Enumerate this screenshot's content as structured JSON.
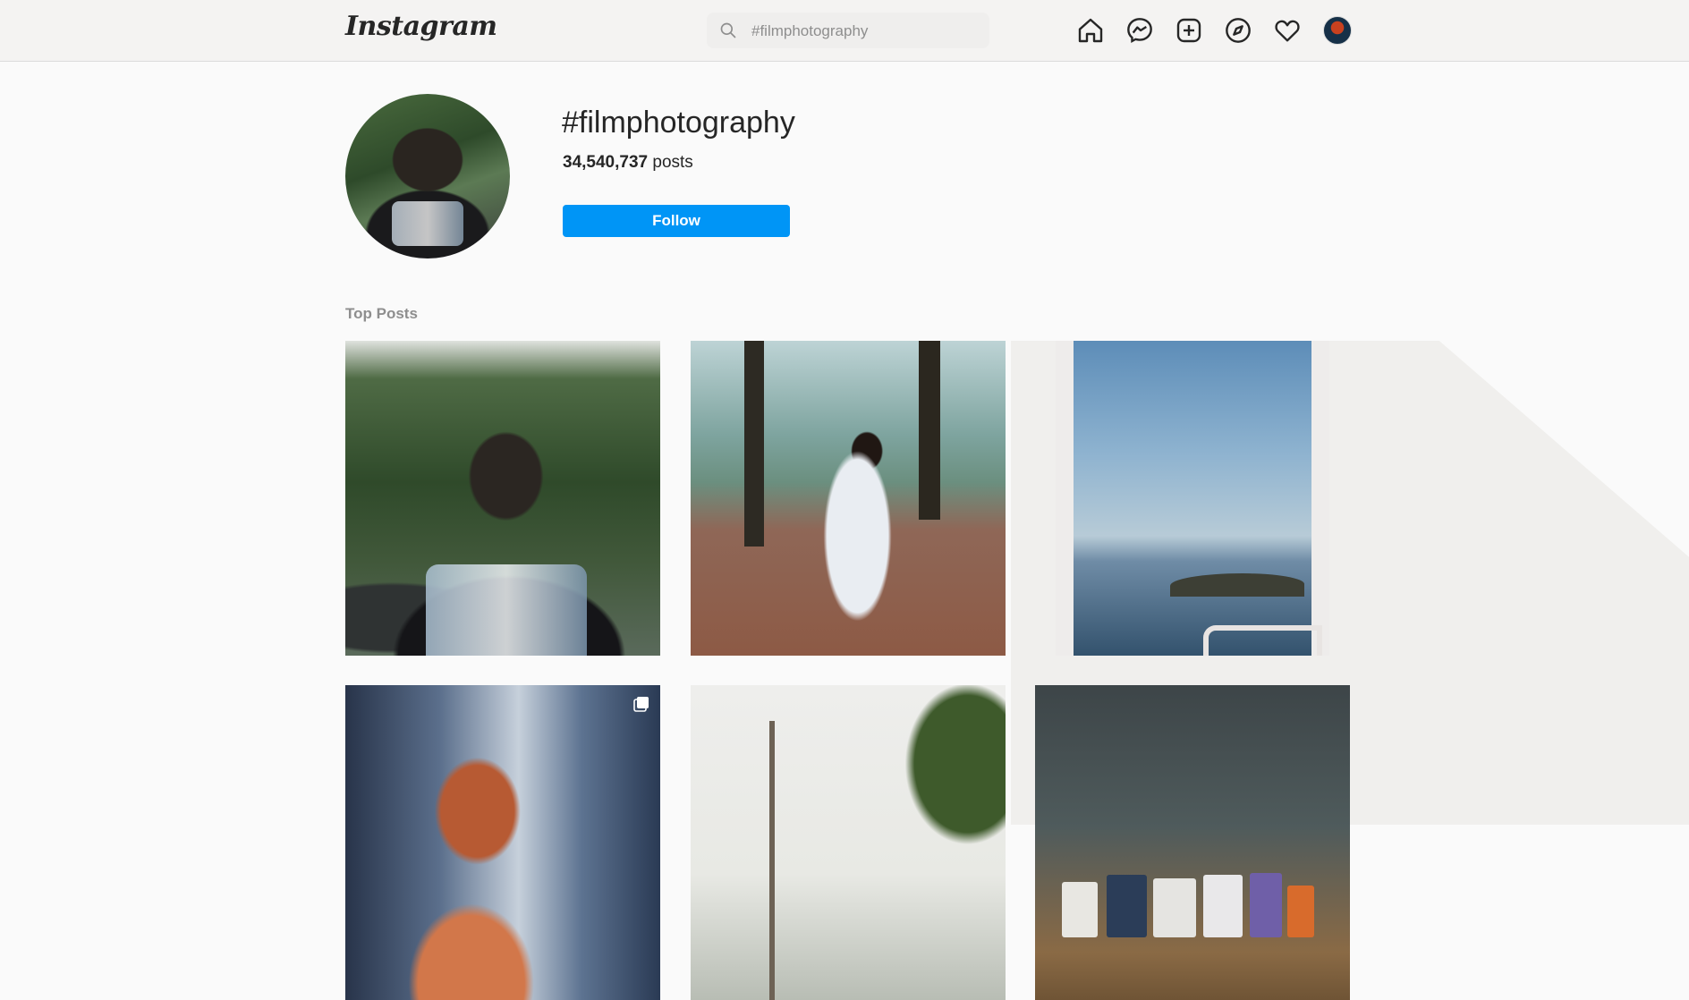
{
  "header": {
    "logo": "Instagram",
    "search": {
      "value": "",
      "placeholder": "#filmphotography"
    },
    "nav_icons": [
      "home-icon",
      "messenger-icon",
      "new-post-icon",
      "explore-icon",
      "activity-heart-icon",
      "profile-avatar"
    ]
  },
  "hashtag": {
    "name": "#filmphotography",
    "post_count": "34,540,737",
    "post_label": "posts",
    "follow_label": "Follow"
  },
  "top_posts": {
    "label": "Top Posts",
    "posts": [
      {
        "subject": "man in black graphic tee among cacti",
        "multi": false
      },
      {
        "subject": "woman in white dress walking in forest",
        "multi": false
      },
      {
        "subject": "seagulls over sea",
        "multi": false
      },
      {
        "subject": "woman with braids",
        "multi": true
      },
      {
        "subject": "power lines and palm tree",
        "multi": false
      },
      {
        "subject": "shelf with product jars",
        "multi": false
      }
    ]
  },
  "colors": {
    "accent": "#0095f6",
    "background": "#fafafa",
    "header_bg": "#f4f3f2"
  }
}
